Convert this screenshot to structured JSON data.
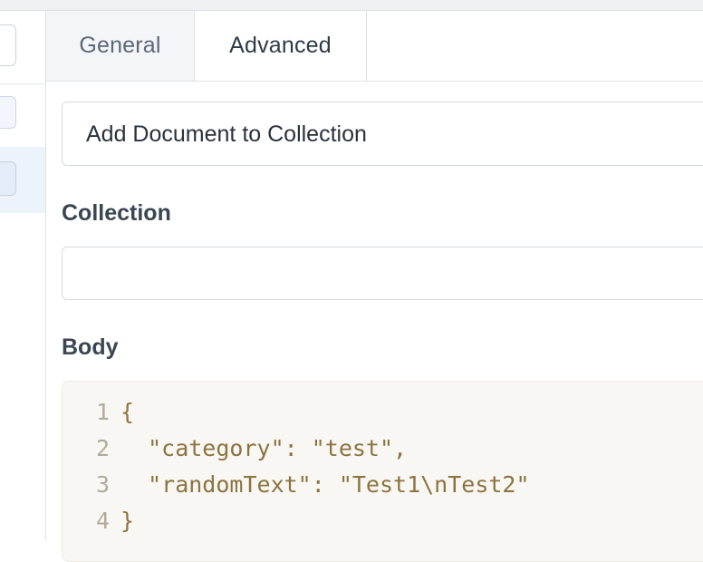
{
  "tabs": [
    {
      "label": "General",
      "active": false
    },
    {
      "label": "Advanced",
      "active": true
    }
  ],
  "action_field": {
    "value": "Add Document to Collection"
  },
  "collection": {
    "label": "Collection",
    "value": ""
  },
  "body": {
    "label": "Body",
    "lines": [
      {
        "number": "1",
        "text": "{"
      },
      {
        "number": "2",
        "text": "  \"category\": \"test\","
      },
      {
        "number": "3",
        "text": "  \"randomText\": \"Test1\\nTest2\""
      },
      {
        "number": "4",
        "text": "}"
      }
    ]
  }
}
